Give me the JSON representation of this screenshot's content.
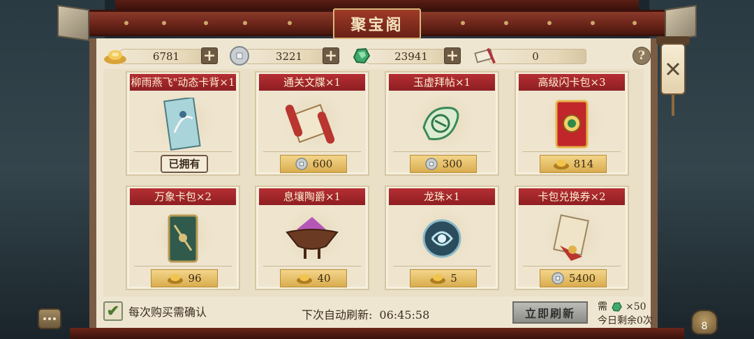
{
  "title": "聚宝阁",
  "currencies": [
    {
      "name": "gold-ingot",
      "value": "6781"
    },
    {
      "name": "silver-coin",
      "value": "3221"
    },
    {
      "name": "jade",
      "value": "23941"
    },
    {
      "name": "scroll-ticket",
      "value": "0"
    }
  ],
  "help_label": "?",
  "items": [
    {
      "title": "柳雨燕飞\"动态卡背×1",
      "status": "已拥有"
    },
    {
      "title": "通关文牒×1",
      "price": "600",
      "currency": "silver"
    },
    {
      "title": "玉虚拜帖×1",
      "price": "300",
      "currency": "silver"
    },
    {
      "title": "高级闪卡包×3",
      "price": "814",
      "currency": "gold"
    },
    {
      "title": "万象卡包×2",
      "price": "96",
      "currency": "gold"
    },
    {
      "title": "息壤陶爵×1",
      "price": "40",
      "currency": "gold"
    },
    {
      "title": "龙珠×1",
      "price": "5",
      "currency": "gold"
    },
    {
      "title": "卡包兑换券×2",
      "price": "5400",
      "currency": "silver"
    }
  ],
  "footer": {
    "confirm_label": "每次购买需确认",
    "refresh_label": "下次自动刷新:",
    "refresh_time": "06:45:58",
    "refresh_button": "立即刷新",
    "need_label": "需",
    "need_amount": "×50",
    "remaining": "今日剩余0次"
  },
  "bag_count": "8",
  "colors": {
    "title_red": "#b52f33",
    "price_gold": "#d9ad4f",
    "panel": "#efe6d2",
    "beam": "#6b2519"
  }
}
